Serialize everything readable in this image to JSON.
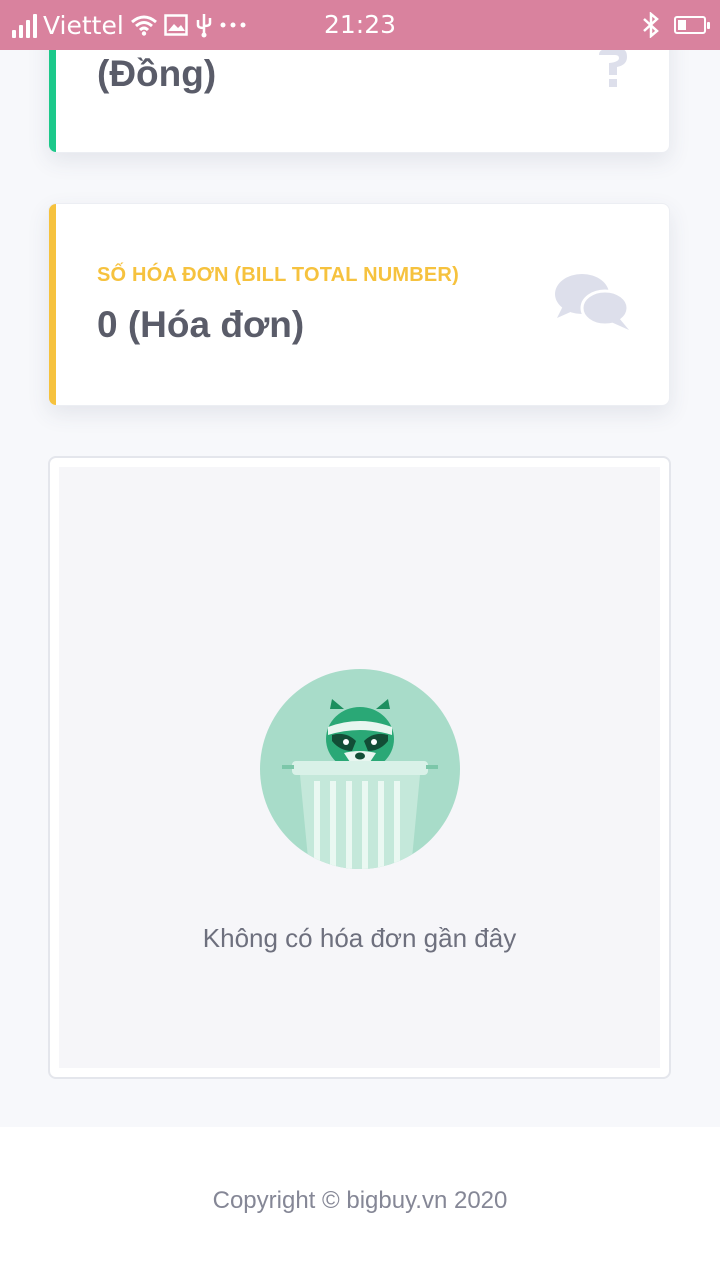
{
  "status_bar": {
    "carrier": "Viettel",
    "time": "21:23",
    "icons": [
      "signal-icon",
      "wifi-icon",
      "image-icon",
      "usb-icon",
      "more-dots-icon",
      "bluetooth-icon",
      "battery-icon"
    ],
    "battery_level": 0.35
  },
  "cards": {
    "revenue": {
      "value": "(Đồng)",
      "icon": "dollar-icon",
      "accent_color": "#1cc88a"
    },
    "bill_count": {
      "label": "SỐ HÓA ĐƠN (BILL TOTAL NUMBER)",
      "value": "0 (Hóa đơn)",
      "icon": "comments-icon",
      "accent_color": "#f6c23e"
    }
  },
  "empty_state": {
    "message": "Không có hóa đơn gần đây",
    "illustration": "raccoon-trash-can-icon"
  },
  "footer": {
    "copyright": "Copyright © bigbuy.vn 2020"
  }
}
